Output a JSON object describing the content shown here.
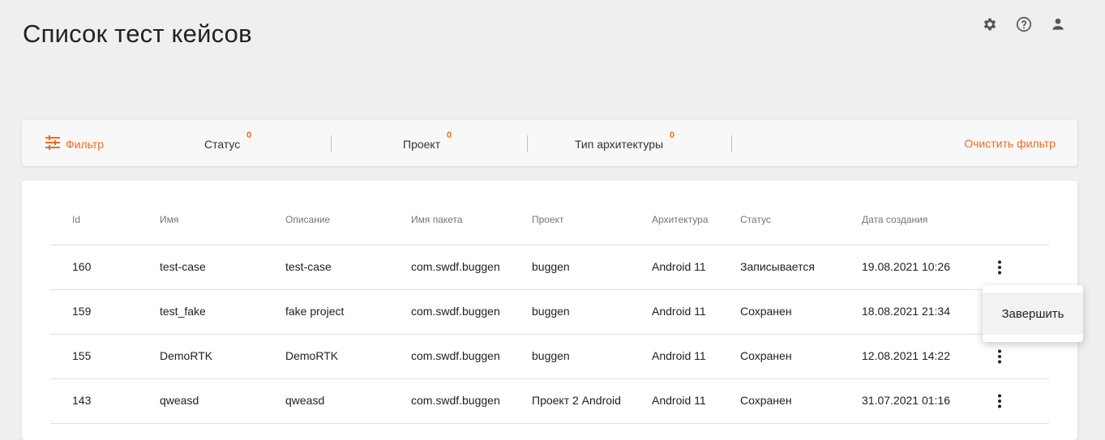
{
  "header": {
    "title": "Список тест кейсов",
    "icons": [
      "gear-icon",
      "help-icon",
      "user-icon"
    ]
  },
  "filter_bar": {
    "filter_label": "Фильтр",
    "items": [
      {
        "label": "Статус",
        "count": "0"
      },
      {
        "label": "Проект",
        "count": "0"
      },
      {
        "label": "Тип архитектуры",
        "count": "0"
      }
    ],
    "clear_label": "Очистить фильтр"
  },
  "table": {
    "columns": [
      "Id",
      "Имя",
      "Описание",
      "Имя пакета",
      "Проект",
      "Архитектура",
      "Статус",
      "Дата создания"
    ],
    "rows": [
      [
        "160",
        "test-case",
        "test-case",
        "com.swdf.buggen",
        "buggen",
        "Android 11",
        "Записывается",
        "19.08.2021 10:26"
      ],
      [
        "159",
        "test_fake",
        "fake project",
        "com.swdf.buggen",
        "buggen",
        "Android 11",
        "Сохранен",
        "18.08.2021 21:34"
      ],
      [
        "155",
        "DemoRTK",
        "DemoRTK",
        "com.swdf.buggen",
        "buggen",
        "Android 11",
        "Сохранен",
        "12.08.2021 14:22"
      ],
      [
        "143",
        "qweasd",
        "qweasd",
        "com.swdf.buggen",
        "Проект 2 Android",
        "Android 11",
        "Сохранен",
        "31.07.2021 01:16"
      ]
    ]
  },
  "context_menu": {
    "item_label": "Завершить"
  },
  "colors": {
    "accent": "#f26b1d",
    "background": "#efefef",
    "card": "#ffffff"
  }
}
